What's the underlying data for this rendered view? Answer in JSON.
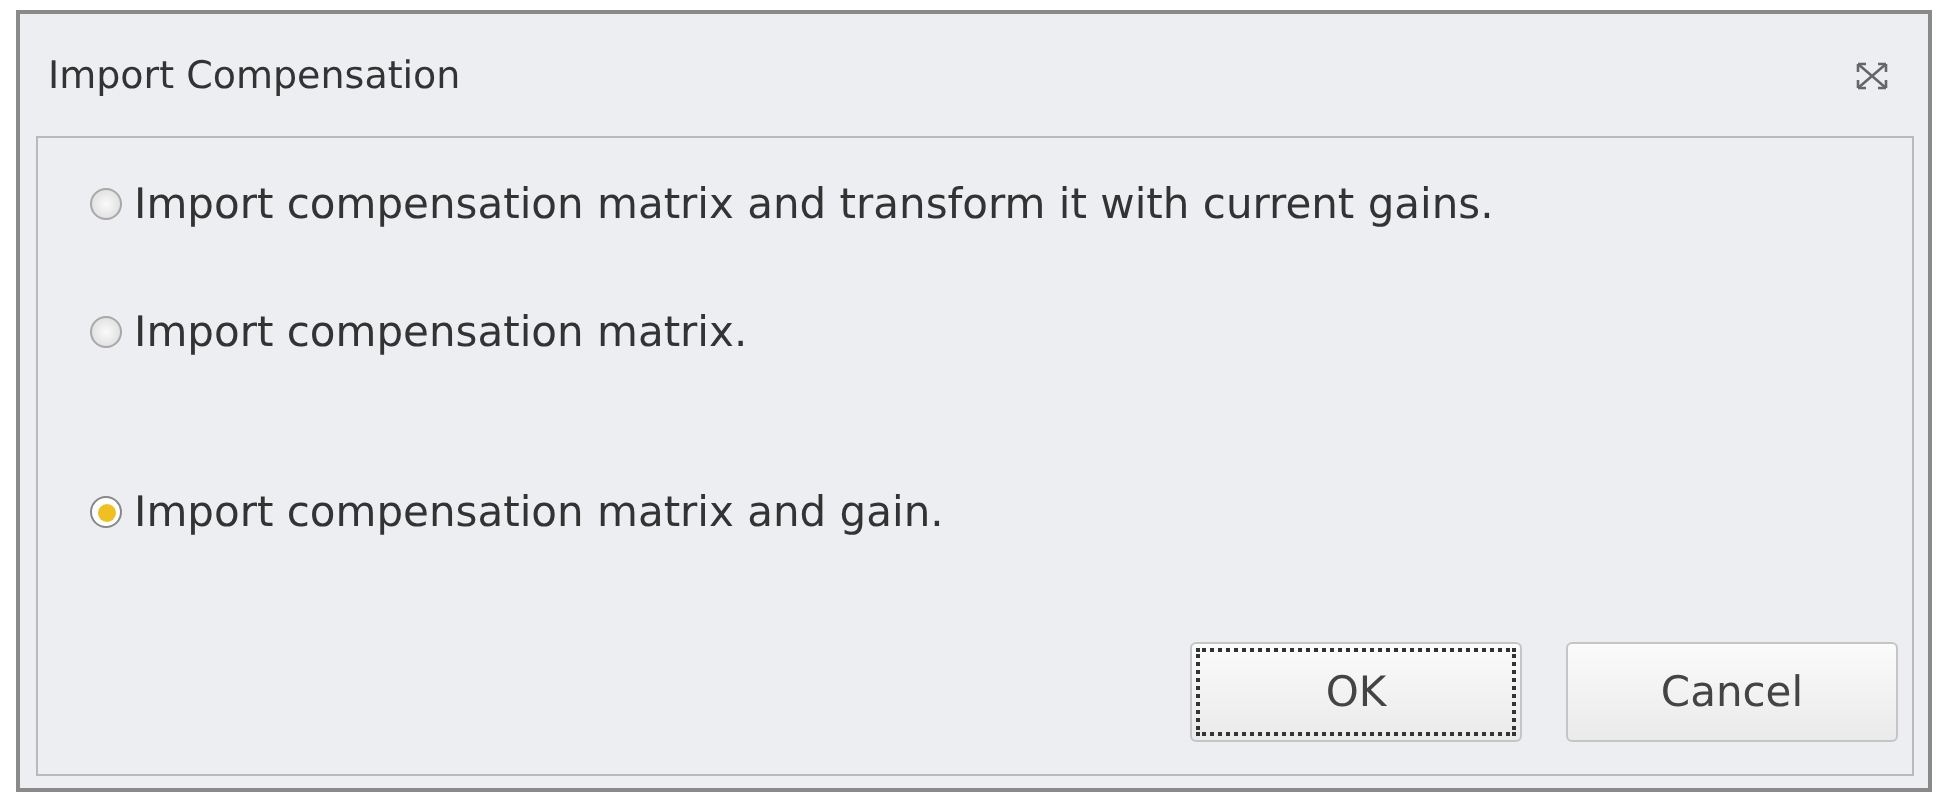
{
  "window": {
    "title": "Import Compensation"
  },
  "options": [
    {
      "label": "Import compensation matrix and transform it with current gains.",
      "selected": false
    },
    {
      "label": "Import compensation matrix.",
      "selected": false
    },
    {
      "label": "Import compensation matrix and gain.",
      "selected": true
    }
  ],
  "buttons": [
    {
      "label": "OK",
      "focused": true
    },
    {
      "label": "Cancel",
      "focused": false
    }
  ]
}
